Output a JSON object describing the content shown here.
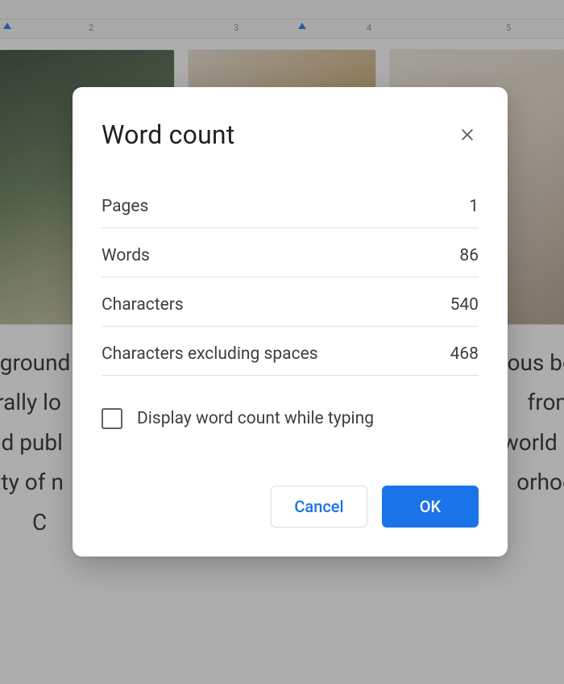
{
  "ruler": {
    "m2": "2",
    "m3": "3",
    "m4": "4",
    "m5": "5"
  },
  "bg_text": {
    "l1": "l ground",
    "l2": "trally lo",
    "l3": "nd publ",
    "l4": "uty of n",
    "l5": "C",
    "r1": "ious bo",
    "r2": "from",
    "r3": "world",
    "r4": "orhoo"
  },
  "dialog": {
    "title": "Word count",
    "rows": [
      {
        "label": "Pages",
        "value": "1"
      },
      {
        "label": "Words",
        "value": "86"
      },
      {
        "label": "Characters",
        "value": "540"
      },
      {
        "label": "Characters excluding spaces",
        "value": "468"
      }
    ],
    "checkbox_label": "Display word count while typing",
    "cancel": "Cancel",
    "ok": "OK"
  }
}
